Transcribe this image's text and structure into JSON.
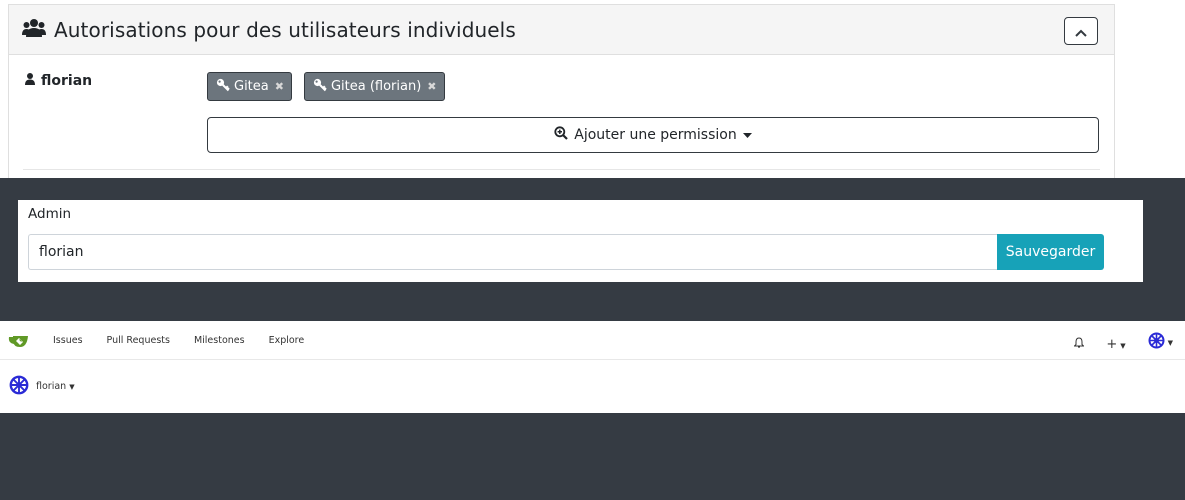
{
  "panel": {
    "title": "Autorisations pour des utilisateurs individuels",
    "user": "florian",
    "tags": [
      {
        "label": "Gitea"
      },
      {
        "label": "Gitea (florian)"
      }
    ],
    "tag_remove_glyph": "✖",
    "add_permission_label": "Ajouter une permission"
  },
  "admin_form": {
    "label": "Admin",
    "input_value": "florian",
    "save_label": "Sauvegarder"
  },
  "gitea": {
    "nav": [
      "Issues",
      "Pull Requests",
      "Milestones",
      "Explore"
    ],
    "add_glyph": "+",
    "user": "florian"
  },
  "colors": {
    "dark_band": "#353b43",
    "tag_bg": "#6c757d",
    "save_btn": "#17a2b8",
    "gitea_green": "#609926",
    "avatar_blue": "#2b2bd6"
  }
}
